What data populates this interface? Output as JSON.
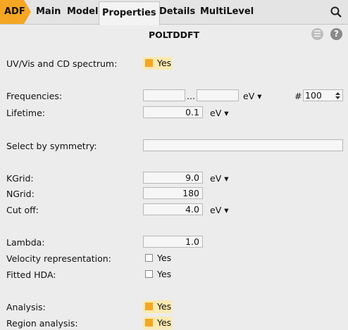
{
  "tabs": {
    "adf": "ADF",
    "main": "Main",
    "model": "Model",
    "properties": "Properties",
    "details": "Details",
    "multilevel": "MultiLevel"
  },
  "page_title": "POLTDDFT",
  "uvvis": {
    "label": "UV/Vis and CD spectrum:",
    "value": "Yes",
    "checked": true
  },
  "frequencies": {
    "label": "Frequencies:",
    "from": "",
    "sep": "...",
    "to": "",
    "unit": "eV ▾",
    "count_prefix": "#",
    "count": "100"
  },
  "lifetime": {
    "label": "Lifetime:",
    "value": "0.1",
    "unit": "eV ▾"
  },
  "symmetry": {
    "label": "Select by symmetry:",
    "value": ""
  },
  "kgrid": {
    "label": "KGrid:",
    "value": "9.0",
    "unit": "eV ▾"
  },
  "ngrid": {
    "label": "NGrid:",
    "value": "180"
  },
  "cutoff": {
    "label": "Cut off:",
    "value": "4.0",
    "unit": "eV ▾"
  },
  "lambda": {
    "label": "Lambda:",
    "value": "1.0"
  },
  "velocity": {
    "label": "Velocity representation:",
    "value": "Yes",
    "checked": false
  },
  "fitted_hda": {
    "label": "Fitted HDA:",
    "value": "Yes",
    "checked": false
  },
  "analysis": {
    "label": "Analysis:",
    "value": "Yes",
    "checked": true
  },
  "region_analysis": {
    "label": "Region analysis:",
    "value": "Yes",
    "checked": true
  },
  "colors": {
    "accent": "#f5a623",
    "checked_bg": "#fbe9b0",
    "icon_gray": "#bdbdbd",
    "help_gray": "#8a8a8a"
  }
}
